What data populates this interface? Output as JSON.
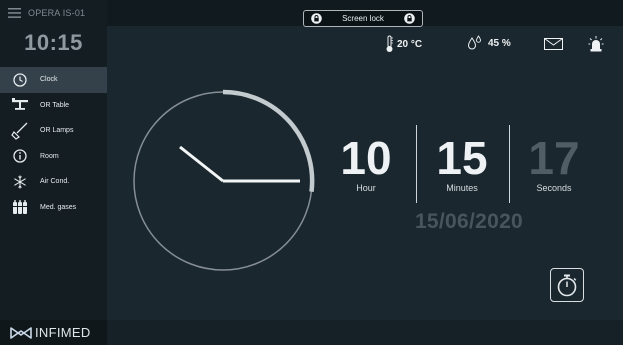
{
  "device_name": "OPERA IS-01",
  "sidebar_time": "10:15",
  "nav_items": [
    {
      "label": "Clock",
      "icon": "clock-icon",
      "active": true
    },
    {
      "label": "OR Table",
      "icon": "or-table-icon"
    },
    {
      "label": "OR Lamps",
      "icon": "or-lamp-icon"
    },
    {
      "label": "Room",
      "icon": "info-icon"
    },
    {
      "label": "Air Cond.",
      "icon": "snowflake-icon"
    },
    {
      "label": "Med. gases",
      "icon": "gas-cylinders-icon"
    }
  ],
  "brand": "INFIMED",
  "screen_lock": {
    "label": "Screen lock"
  },
  "status": {
    "temperature": "20 °C",
    "humidity": "45 %",
    "icons": [
      "thermometer-icon",
      "humidity-icon",
      "mail-icon",
      "alarm-light-icon"
    ]
  },
  "clock": {
    "hour": "10",
    "minutes": "15",
    "seconds": "17",
    "hour_label": "Hour",
    "minutes_label": "Minutes",
    "seconds_label": "Seconds",
    "date": "15/06/2020"
  },
  "colors": {
    "background": "#1b272e",
    "sidebar": "#141d22",
    "active_nav": "#34414a",
    "text": "#e8edf0",
    "dim_seconds": "#505d64",
    "date": "#48555d"
  }
}
